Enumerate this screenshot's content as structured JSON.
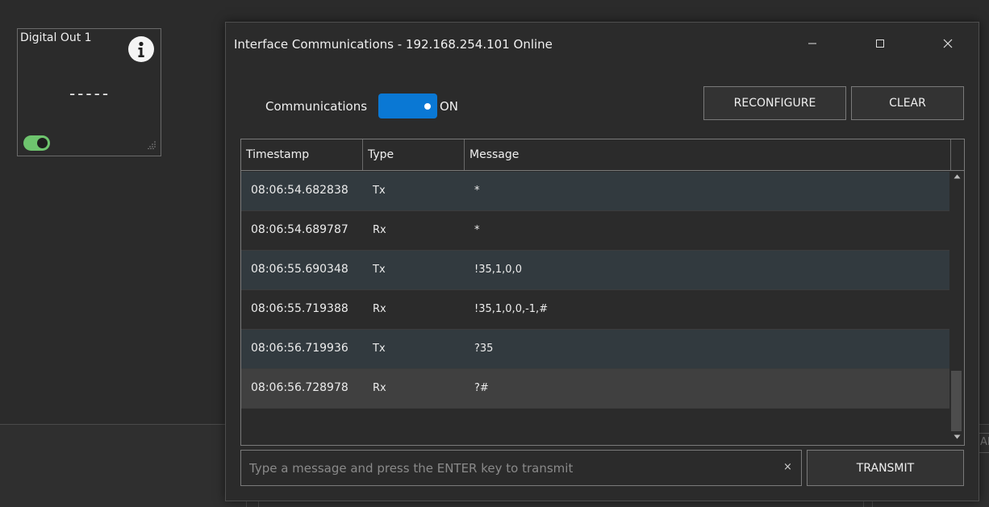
{
  "tile": {
    "title": "Digital Out 1",
    "value": "-----",
    "info_icon": "info-icon",
    "toggle_on": true,
    "toggle_color": "#6ec46e"
  },
  "background": {
    "edge_text": "AB"
  },
  "dialog": {
    "title": "Interface Communications - 192.168.254.101 Online",
    "window_controls": [
      "minimize-icon",
      "maximize-icon",
      "close-icon"
    ],
    "communications_label": "Communications",
    "communications_state": "ON",
    "toggle_color": "#0a78d4",
    "reconfigure_label": "RECONFIGURE",
    "clear_label": "CLEAR",
    "columns": {
      "timestamp": "Timestamp",
      "type": "Type",
      "message": "Message"
    },
    "rows": [
      {
        "timestamp": "08:06:54.682838",
        "type": "Tx",
        "message": "*"
      },
      {
        "timestamp": "08:06:54.689787",
        "type": "Rx",
        "message": "*"
      },
      {
        "timestamp": "08:06:55.690348",
        "type": "Tx",
        "message": "!35,1,0,0"
      },
      {
        "timestamp": "08:06:55.719388",
        "type": "Rx",
        "message": "!35,1,0,0,-1,#"
      },
      {
        "timestamp": "08:06:56.719936",
        "type": "Tx",
        "message": "?35"
      },
      {
        "timestamp": "08:06:56.728978",
        "type": "Rx",
        "message": "?#"
      }
    ],
    "selected_row": 5,
    "input": {
      "value": "",
      "placeholder": "Type a message and press the ENTER key to transmit",
      "clear_glyph": "×"
    },
    "transmit_label": "TRANSMIT"
  }
}
